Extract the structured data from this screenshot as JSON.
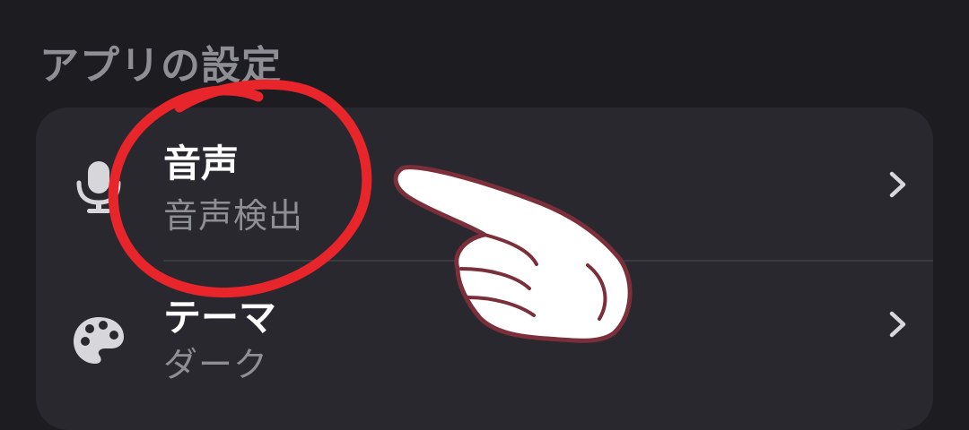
{
  "section": {
    "title": "アプリの設定"
  },
  "settings": {
    "items": [
      {
        "title": "音声",
        "subtitle": "音声検出",
        "icon": "microphone-icon"
      },
      {
        "title": "テーマ",
        "subtitle": "ダーク",
        "icon": "palette-icon"
      }
    ]
  },
  "annotation": {
    "circle_color": "#e8252a",
    "hand_outline_color": "#7a2f3a"
  },
  "colors": {
    "background": "#1c1c21",
    "card": "#28282e",
    "primary_text": "#ffffff",
    "secondary_text": "#8e8e95"
  }
}
